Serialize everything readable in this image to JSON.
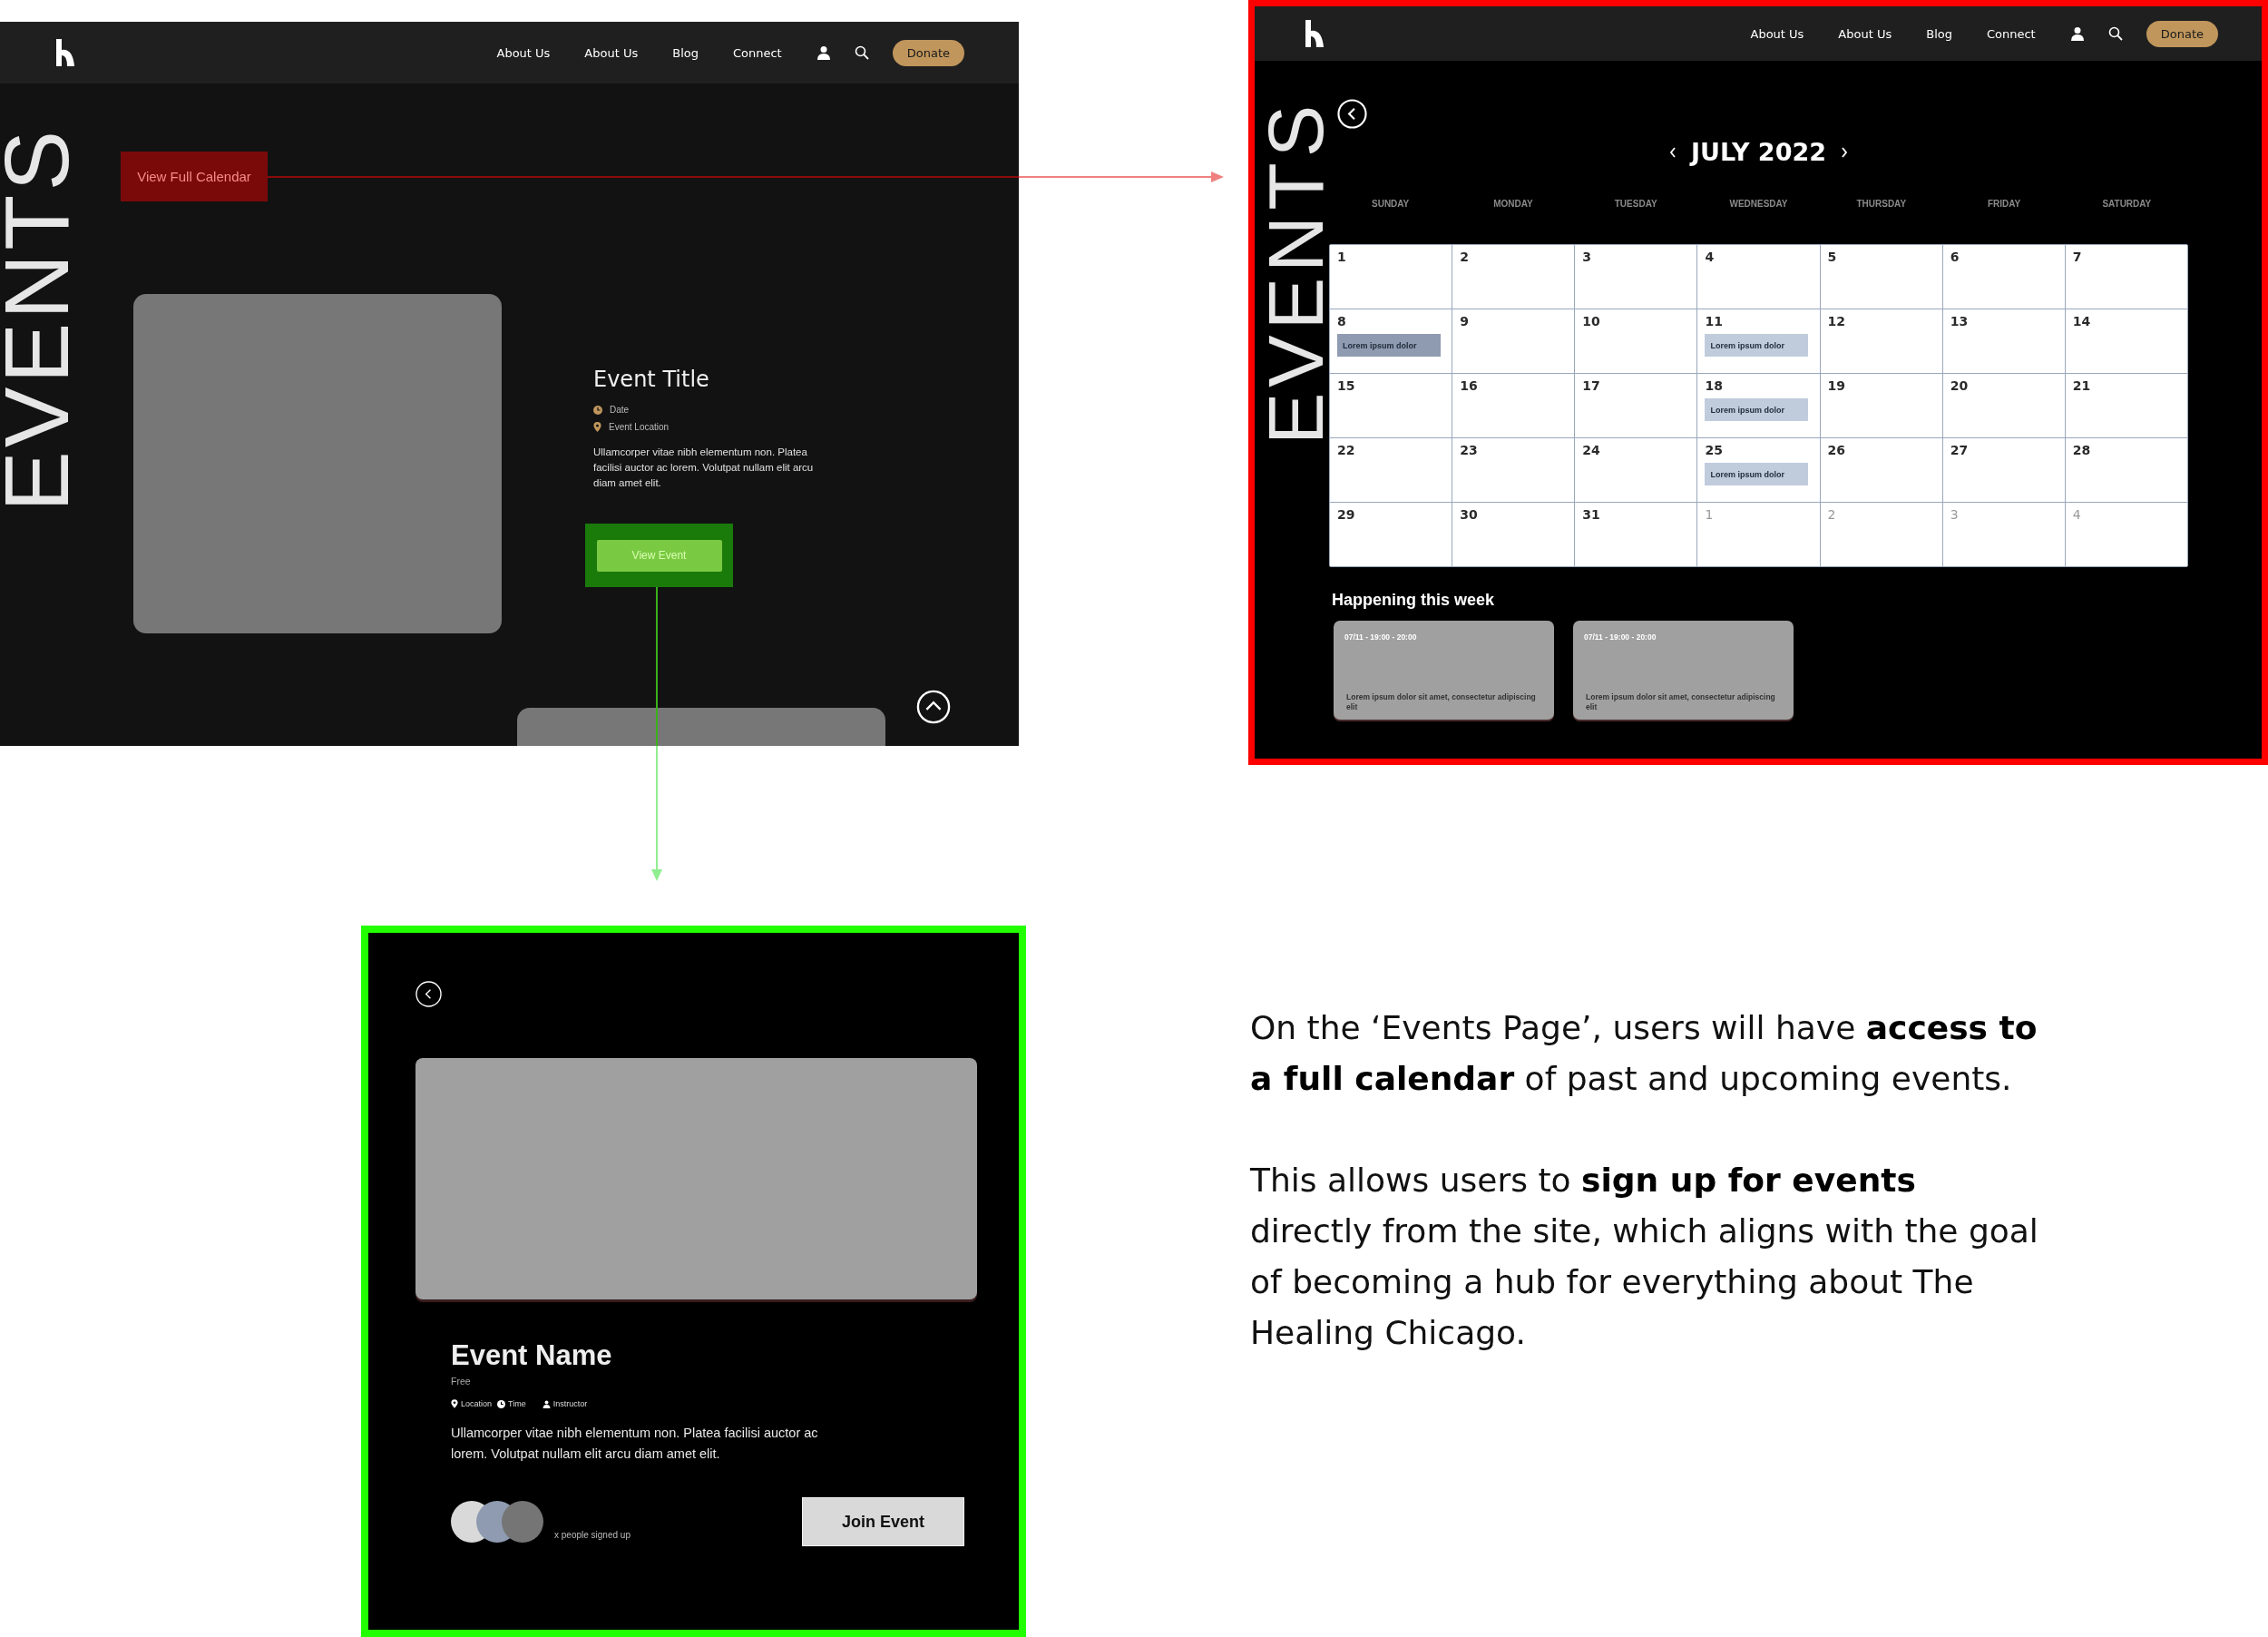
{
  "home_page": {
    "nav": {
      "links": [
        "About Us",
        "About Us",
        "Blog",
        "Connect"
      ],
      "donate": "Donate"
    },
    "side_title": "EVENTS",
    "calendar_button": "View Full Calendar",
    "event": {
      "title": "Event Title",
      "date": "Date",
      "location": "Event Location",
      "description": "Ullamcorper vitae nibh elementum non. Platea facilisi auctor ac lorem. Volutpat nullam elit arcu diam amet elit.",
      "button": "View Event"
    }
  },
  "calendar_page": {
    "nav": {
      "links": [
        "About Us",
        "About Us",
        "Blog",
        "Connect"
      ],
      "donate": "Donate"
    },
    "side_title": "EVENTS",
    "month": "JULY 2022",
    "weekdays": [
      "SUNDAY",
      "MONDAY",
      "TUESDAY",
      "WEDNESDAY",
      "THURSDAY",
      "FRIDAY",
      "SATURDAY"
    ],
    "weeks": [
      [
        {
          "day": "1",
          "in_month": true
        },
        {
          "day": "2",
          "in_month": true
        },
        {
          "day": "3",
          "in_month": true
        },
        {
          "day": "4",
          "in_month": true
        },
        {
          "day": "5",
          "in_month": true
        },
        {
          "day": "6",
          "in_month": true
        },
        {
          "day": "7",
          "in_month": true
        }
      ],
      [
        {
          "day": "8",
          "in_month": true,
          "events": [
            {
              "label": "Lorem ipsum dolor",
              "color": "#8e9bb0"
            }
          ]
        },
        {
          "day": "9",
          "in_month": true
        },
        {
          "day": "10",
          "in_month": true
        },
        {
          "day": "11",
          "in_month": true,
          "events": [
            {
              "label": "Lorem ipsum dolor",
              "color": "#c0ccdc"
            }
          ]
        },
        {
          "day": "12",
          "in_month": true
        },
        {
          "day": "13",
          "in_month": true
        },
        {
          "day": "14",
          "in_month": true
        }
      ],
      [
        {
          "day": "15",
          "in_month": true
        },
        {
          "day": "16",
          "in_month": true
        },
        {
          "day": "17",
          "in_month": true
        },
        {
          "day": "18",
          "in_month": true,
          "events": [
            {
              "label": "Lorem ipsum dolor",
              "color": "#c0ccdc"
            }
          ]
        },
        {
          "day": "19",
          "in_month": true
        },
        {
          "day": "20",
          "in_month": true
        },
        {
          "day": "21",
          "in_month": true
        }
      ],
      [
        {
          "day": "22",
          "in_month": true
        },
        {
          "day": "23",
          "in_month": true
        },
        {
          "day": "24",
          "in_month": true
        },
        {
          "day": "25",
          "in_month": true,
          "events": [
            {
              "label": "Lorem ipsum dolor",
              "color": "#c0ccdc"
            }
          ]
        },
        {
          "day": "26",
          "in_month": true
        },
        {
          "day": "27",
          "in_month": true
        },
        {
          "day": "28",
          "in_month": true
        }
      ],
      [
        {
          "day": "29",
          "in_month": true
        },
        {
          "day": "30",
          "in_month": true
        },
        {
          "day": "31",
          "in_month": true
        },
        {
          "day": "1",
          "in_month": false
        },
        {
          "day": "2",
          "in_month": false
        },
        {
          "day": "3",
          "in_month": false
        },
        {
          "day": "4",
          "in_month": false
        }
      ]
    ],
    "happening_title": "Happening this week",
    "cards": [
      {
        "time": "07/11 - 19:00 - 20:00",
        "text": "Lorem ipsum dolor sit amet, consectetur adipiscing elit"
      },
      {
        "time": "07/11 - 19:00 - 20:00",
        "text": "Lorem ipsum dolor sit amet, consectetur adipiscing elit"
      }
    ]
  },
  "event_page": {
    "title": "Event Name",
    "price": "Free",
    "meta": [
      {
        "kind": "location",
        "label": "Location"
      },
      {
        "kind": "time",
        "label": "Time"
      },
      {
        "kind": "instructor",
        "label": "Instructor"
      }
    ],
    "description": "Ullamcorper vitae nibh elementum non. Platea facilisi auctor ac lorem. Volutpat nullam elit arcu diam amet elit.",
    "avatars": [
      {
        "color": "#d9d9d9"
      },
      {
        "color": "#8e9bb0"
      },
      {
        "color": "#757575"
      }
    ],
    "signed_up": "x people signed up",
    "button": "Join Event"
  },
  "description": [
    "On the ‘Events Page’, users will have **access to a full calendar** of past and upcoming events.",
    "This allows users to **sign up for events** directly from the site, which aligns with the goal of becoming a hub for everything about The Healing Chicago."
  ]
}
